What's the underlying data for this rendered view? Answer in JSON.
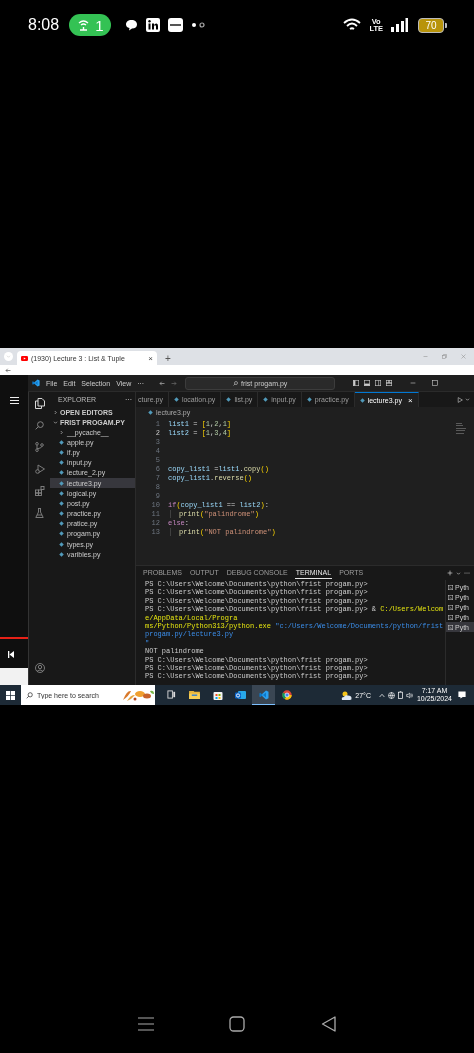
{
  "status_bar": {
    "time": "8:08",
    "hotspot_count": "1",
    "network": [
      "Vo",
      "LTE"
    ],
    "battery": "70"
  },
  "browser": {
    "tab": {
      "title": "(1930) Lecture 3 : List & Tuple",
      "close": "×"
    },
    "new_tab": "+"
  },
  "vscode": {
    "menu": [
      "File",
      "Edit",
      "Selection",
      "View",
      "···"
    ],
    "command_center": "frist progam.py",
    "explorer": {
      "title": "EXPLORER",
      "more": "···",
      "sections": [
        {
          "label": "OPEN EDITORS",
          "expanded": false
        },
        {
          "label": "FRIST PROGAM.PY",
          "expanded": true,
          "children": [
            {
              "label": "__pycache__",
              "kind": "folder",
              "expanded": false,
              "selected": false
            },
            {
              "label": "apple.py",
              "kind": "file",
              "selected": false
            },
            {
              "label": "if.py",
              "kind": "file",
              "selected": false
            },
            {
              "label": "input.py",
              "kind": "file",
              "selected": false
            },
            {
              "label": "lecture_2.py",
              "kind": "file",
              "selected": false
            },
            {
              "label": "lecture3.py",
              "kind": "file",
              "selected": true
            },
            {
              "label": "logical.py",
              "kind": "file",
              "selected": false
            },
            {
              "label": "post.py",
              "kind": "file",
              "selected": false
            },
            {
              "label": "practice.py",
              "kind": "file",
              "selected": false
            },
            {
              "label": "pratice.py",
              "kind": "file",
              "selected": false
            },
            {
              "label": "progam.py",
              "kind": "file",
              "selected": false
            },
            {
              "label": "types.py",
              "kind": "file",
              "selected": false
            },
            {
              "label": "varibles.py",
              "kind": "file",
              "selected": false
            }
          ]
        }
      ]
    },
    "tabs": [
      {
        "label": "cture.py",
        "kind": "clipped",
        "selected": false
      },
      {
        "label": "location.py",
        "kind": "file",
        "selected": false
      },
      {
        "label": "list.py",
        "kind": "file",
        "selected": false
      },
      {
        "label": "input.py",
        "kind": "file",
        "selected": false
      },
      {
        "label": "practice.py",
        "kind": "file",
        "selected": false
      },
      {
        "label": "lecture3.py",
        "kind": "file",
        "selected": true,
        "close": "×"
      }
    ],
    "breadcrumb": "lecture3.py",
    "code": [
      {
        "number": "1",
        "current": false,
        "tokens": [
          {
            "text": "list1",
            "kind": "var"
          },
          {
            "text": " = ",
            "kind": "op"
          },
          {
            "text": "[",
            "kind": "bracket"
          },
          {
            "text": "1",
            "kind": "num"
          },
          {
            "text": ",",
            "kind": "op"
          },
          {
            "text": "2",
            "kind": "num"
          },
          {
            "text": ",",
            "kind": "op"
          },
          {
            "text": "1",
            "kind": "num"
          },
          {
            "text": "]",
            "kind": "bracket"
          }
        ]
      },
      {
        "number": "2",
        "current": true,
        "tokens": [
          {
            "text": "list2",
            "kind": "var"
          },
          {
            "text": " = ",
            "kind": "op"
          },
          {
            "text": "[",
            "kind": "bracket"
          },
          {
            "text": "1",
            "kind": "num"
          },
          {
            "text": ",",
            "kind": "op"
          },
          {
            "text": "3",
            "kind": "num"
          },
          {
            "text": ",",
            "kind": "op"
          },
          {
            "text": "4",
            "kind": "num"
          },
          {
            "text": "]",
            "kind": "bracket"
          }
        ]
      },
      {
        "number": "3",
        "current": false
      },
      {
        "number": "4",
        "current": false
      },
      {
        "number": "5",
        "current": false
      },
      {
        "number": "6",
        "current": false,
        "tokens": [
          {
            "text": "copy_list1",
            "kind": "var"
          },
          {
            "text": " =",
            "kind": "op"
          },
          {
            "text": "list1",
            "kind": "var"
          },
          {
            "text": ".",
            "kind": "op"
          },
          {
            "text": "copy",
            "kind": "fn"
          },
          {
            "text": "()",
            "kind": "bracket"
          }
        ]
      },
      {
        "number": "7",
        "current": false,
        "tokens": [
          {
            "text": "copy_list1",
            "kind": "var"
          },
          {
            "text": ".",
            "kind": "op"
          },
          {
            "text": "reverse",
            "kind": "fn"
          },
          {
            "text": "()",
            "kind": "bracket"
          }
        ]
      },
      {
        "number": "8",
        "current": false
      },
      {
        "number": "9",
        "current": false
      },
      {
        "number": "10",
        "current": false,
        "tokens": [
          {
            "text": "if",
            "kind": "kw"
          },
          {
            "text": "(",
            "kind": "bracket"
          },
          {
            "text": "copy_list1",
            "kind": "var"
          },
          {
            "text": " == ",
            "kind": "op"
          },
          {
            "text": "list2",
            "kind": "var"
          },
          {
            "text": ")",
            "kind": "bracket"
          },
          {
            "text": ":",
            "kind": "op"
          }
        ]
      },
      {
        "number": "11",
        "current": false,
        "indented": true,
        "tokens": [
          {
            "text": "print",
            "kind": "fn"
          },
          {
            "text": "(",
            "kind": "bracket"
          },
          {
            "text": "\"palindrome\"",
            "kind": "str"
          },
          {
            "text": ")",
            "kind": "bracket"
          }
        ]
      },
      {
        "number": "12",
        "current": false,
        "tokens": [
          {
            "text": "else",
            "kind": "kw"
          },
          {
            "text": ":",
            "kind": "op"
          }
        ]
      },
      {
        "number": "13",
        "current": false,
        "indented": true,
        "tokens": [
          {
            "text": "print",
            "kind": "fn"
          },
          {
            "text": "(",
            "kind": "bracket"
          },
          {
            "text": "\"NOT palindrome\"",
            "kind": "str"
          },
          {
            "text": ")",
            "kind": "bracket"
          }
        ]
      }
    ],
    "panel": {
      "tabs": [
        {
          "label": "PROBLEMS",
          "selected": false
        },
        {
          "label": "OUTPUT",
          "selected": false
        },
        {
          "label": "DEBUG CONSOLE",
          "selected": false
        },
        {
          "label": "TERMINAL",
          "selected": true
        },
        {
          "label": "PORTS",
          "selected": false
        }
      ],
      "terminal_lines": [
        [
          {
            "text": "PS C:\\Users\\Welcome\\Documents\\python\\frist progam.py>",
            "kind": "plain"
          }
        ],
        [
          {
            "text": "PS C:\\Users\\Welcome\\Documents\\python\\frist progam.py>",
            "kind": "plain"
          }
        ],
        [
          {
            "text": "PS C:\\Users\\Welcome\\Documents\\python\\frist progam.py>",
            "kind": "plain"
          }
        ],
        [
          {
            "text": "PS C:\\Users\\Welcome\\Documents\\python\\frist progam.py> & ",
            "kind": "plain"
          },
          {
            "text": "C:/Users/Welcome/AppData/Local/Progra",
            "kind": "cmd"
          }
        ],
        [
          {
            "text": "ms/Python/Python313/python.exe ",
            "kind": "cmd"
          },
          {
            "text": "\"c:/Users/Welcome/Documents/python/frist progam.py/lecture3.py",
            "kind": "path"
          }
        ],
        [
          {
            "text": "\"",
            "kind": "path"
          }
        ],
        [
          {
            "text": "NOT palindrome",
            "kind": "plain"
          }
        ],
        [
          {
            "text": "PS C:\\Users\\Welcome\\Documents\\python\\frist progam.py>",
            "kind": "plain"
          }
        ],
        [
          {
            "text": "PS C:\\Users\\Welcome\\Documents\\python\\frist progam.py>",
            "kind": "plain"
          }
        ],
        [
          {
            "text": "PS C:\\Users\\Welcome\\Documents\\python\\frist progam.py>",
            "kind": "plain"
          }
        ]
      ],
      "terminals": [
        {
          "label": "Pyth",
          "selected": false
        },
        {
          "label": "Pyth",
          "selected": false
        },
        {
          "label": "Pyth",
          "selected": false
        },
        {
          "label": "Pyth",
          "selected": false
        },
        {
          "label": "Pyth",
          "selected": true
        }
      ]
    }
  },
  "taskbar": {
    "search": {
      "placeholder": "Type here to search"
    },
    "apps": [
      {
        "kind": "task-view",
        "selected": false
      },
      {
        "kind": "files",
        "selected": false
      },
      {
        "kind": "store",
        "selected": false
      },
      {
        "kind": "mail",
        "selected": false
      },
      {
        "kind": "vscode",
        "selected": true
      },
      {
        "kind": "browser",
        "selected": false
      }
    ],
    "weather": "27°C",
    "time": "7:17 AM",
    "date": "10/25/2024"
  }
}
